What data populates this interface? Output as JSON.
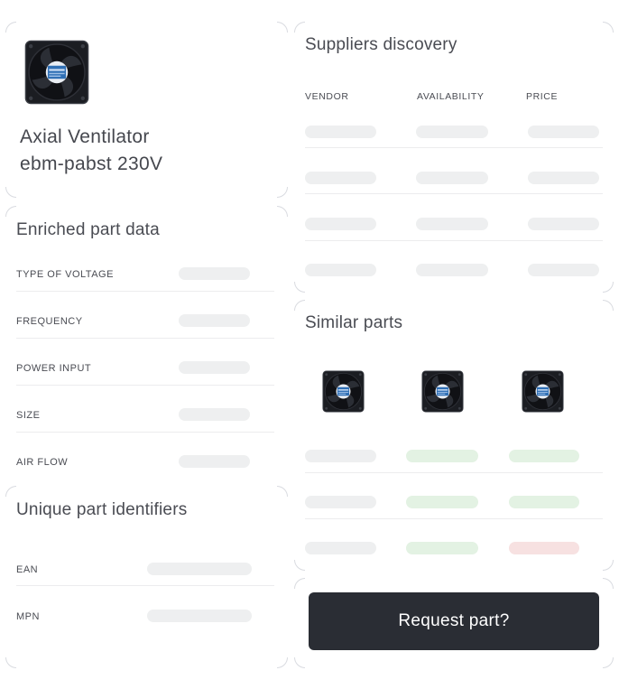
{
  "product": {
    "name_line1": "Axial Ventilator",
    "name_line2": "ebm-pabst 230V",
    "image_icon": "axial-fan-icon"
  },
  "enriched": {
    "title": "Enriched part data",
    "fields": [
      "TYPE OF VOLTAGE",
      "FREQUENCY",
      "POWER INPUT",
      "SIZE",
      "AIR FLOW"
    ]
  },
  "identifiers": {
    "title": "Unique part identifiers",
    "fields": [
      "EAN",
      "MPN"
    ]
  },
  "suppliers": {
    "title": "Suppliers discovery",
    "columns": [
      "VENDOR",
      "AVAILABILITY",
      "PRICE"
    ]
  },
  "similar": {
    "title": "Similar parts",
    "thumb_icon": "axial-fan-icon",
    "status_colors": {
      "positive": "#e3f2e3",
      "negative": "#f7e1e1"
    }
  },
  "cta": {
    "label": "Request part?"
  },
  "colors": {
    "cta_background": "#2a2d34",
    "skeleton": "#eeeff0"
  }
}
